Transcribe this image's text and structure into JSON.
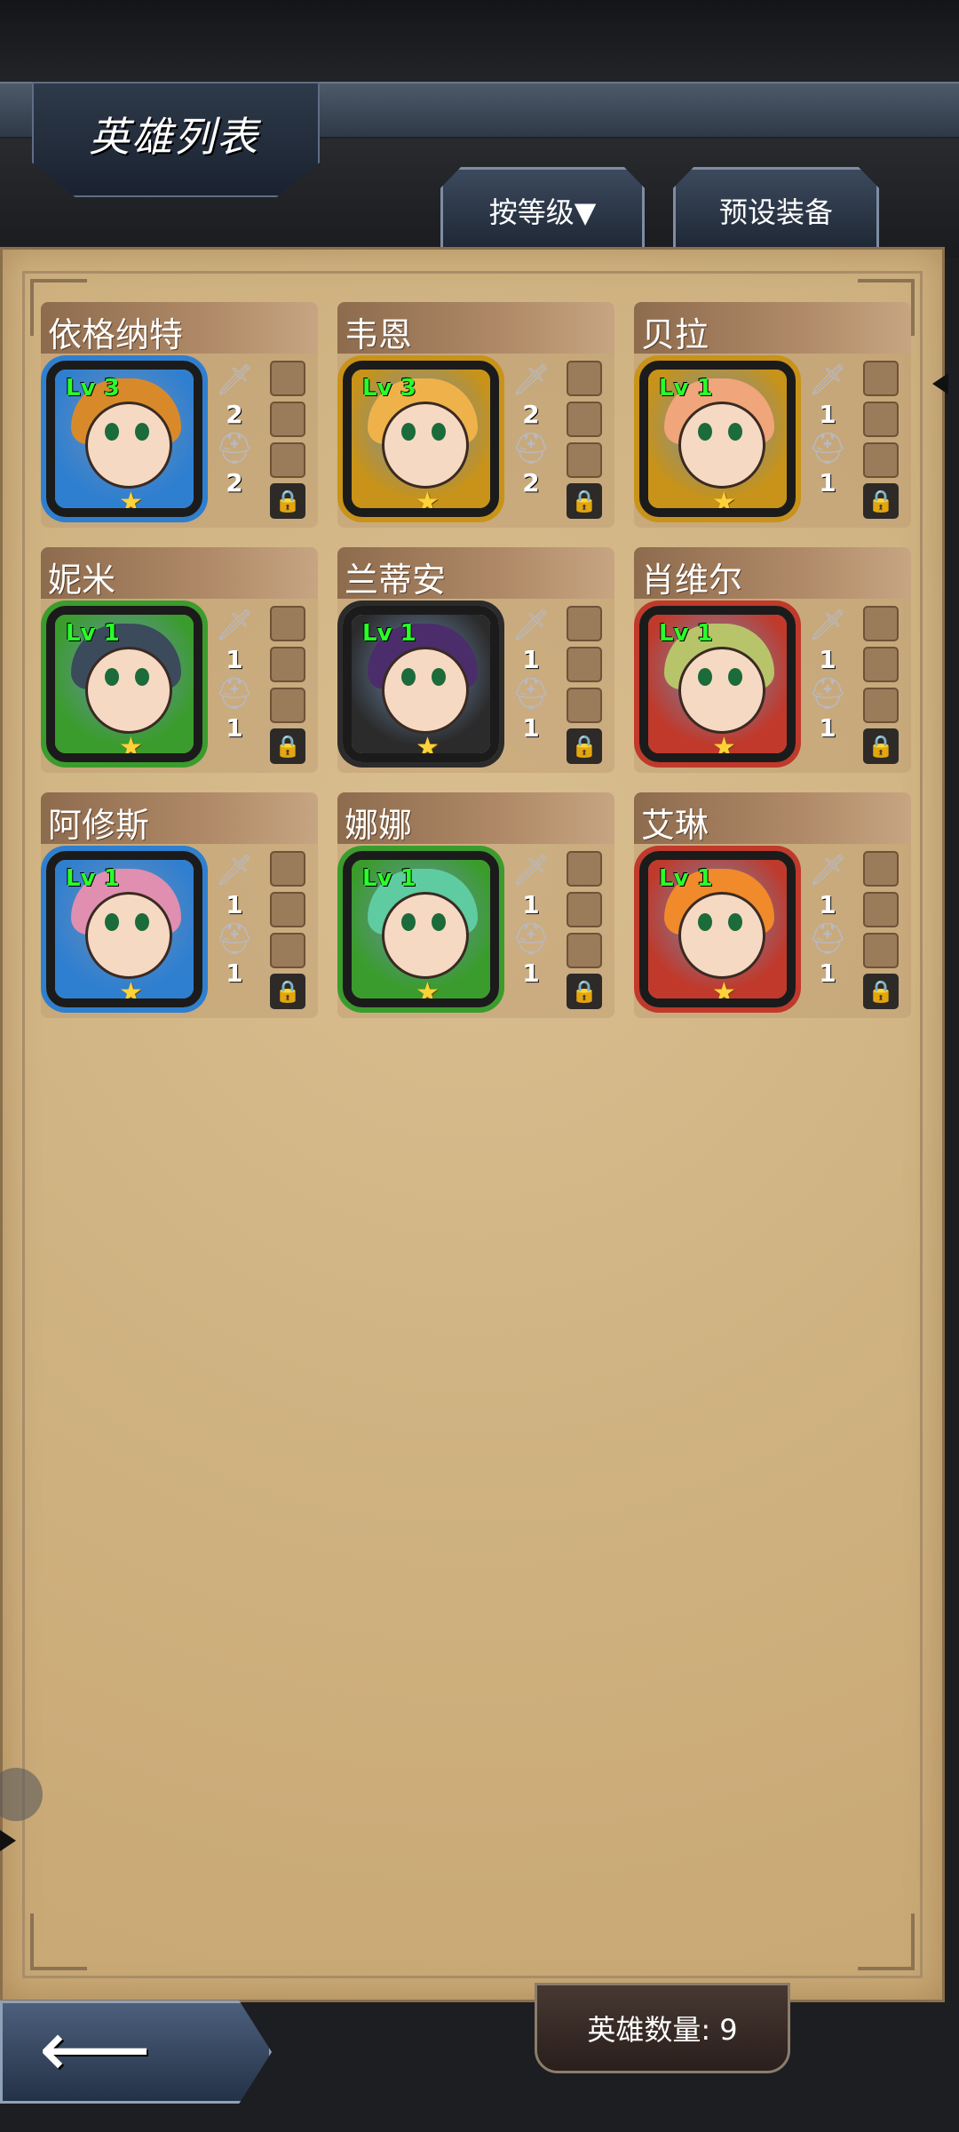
{
  "header": {
    "title": "英雄列表",
    "sort_label": "按等级▼",
    "preset_label": "预设装备"
  },
  "heroes": [
    {
      "name": "依格纳特",
      "level": "Lv 3",
      "weapon": "2",
      "armor": "2",
      "frame_color": "#2f7fd0",
      "hair_color": "#d88a2a",
      "stars": 1
    },
    {
      "name": "韦恩",
      "level": "Lv 3",
      "weapon": "2",
      "armor": "2",
      "frame_color": "#c89318",
      "hair_color": "#efb24a",
      "stars": 1
    },
    {
      "name": "贝拉",
      "level": "Lv 1",
      "weapon": "1",
      "armor": "1",
      "frame_color": "#c89318",
      "hair_color": "#f0a57a",
      "stars": 1
    },
    {
      "name": "妮米",
      "level": "Lv 1",
      "weapon": "1",
      "armor": "1",
      "frame_color": "#3a9c2c",
      "hair_color": "#3b4b5c",
      "stars": 1
    },
    {
      "name": "兰蒂安",
      "level": "Lv 1",
      "weapon": "1",
      "armor": "1",
      "frame_color": "#2b2b2b",
      "hair_color": "#4b2d6b",
      "stars": 1
    },
    {
      "name": "肖维尔",
      "level": "Lv 1",
      "weapon": "1",
      "armor": "1",
      "frame_color": "#c0392b",
      "hair_color": "#b8c46a",
      "stars": 1
    },
    {
      "name": "阿修斯",
      "level": "Lv 1",
      "weapon": "1",
      "armor": "1",
      "frame_color": "#2f7fd0",
      "hair_color": "#e08fb0",
      "stars": 1
    },
    {
      "name": "娜娜",
      "level": "Lv 1",
      "weapon": "1",
      "armor": "1",
      "frame_color": "#3a9c2c",
      "hair_color": "#5fcba0",
      "stars": 1
    },
    {
      "name": "艾琳",
      "level": "Lv 1",
      "weapon": "1",
      "armor": "1",
      "frame_color": "#c0392b",
      "hair_color": "#f08a2a",
      "stars": 1
    }
  ],
  "footer": {
    "hero_count": "英雄数量: 9",
    "back_icon": "back-arrow-icon"
  },
  "icons": {
    "weapon": "sword-icon",
    "armor": "helmet-icon",
    "lock": "lock-icon",
    "star": "star-icon"
  }
}
